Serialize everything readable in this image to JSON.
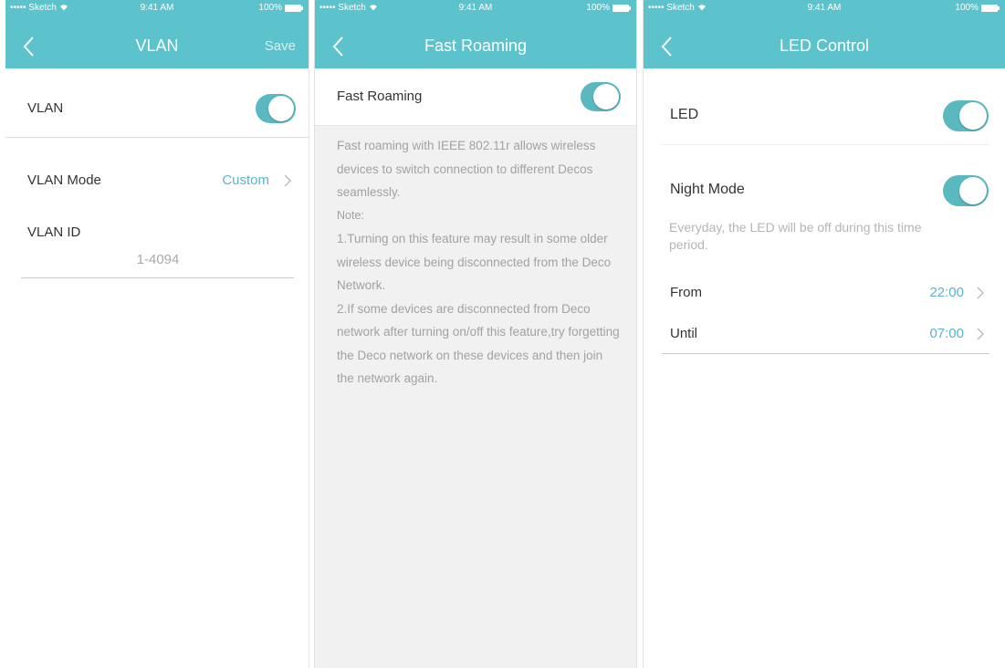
{
  "status_bar": {
    "carrier": "••••• Sketch",
    "time": "9:41 AM",
    "battery": "100%"
  },
  "vlan_screen": {
    "title": "VLAN",
    "save_label": "Save",
    "vlan_toggle_label": "VLAN",
    "vlan_enabled": true,
    "mode_label": "VLAN Mode",
    "mode_value": "Custom",
    "id_label": "VLAN ID",
    "id_placeholder": "1-4094"
  },
  "fast_roaming_screen": {
    "title": "Fast Roaming",
    "toggle_label": "Fast Roaming",
    "enabled": true,
    "description": "Fast roaming with IEEE 802.11r allows wireless devices to switch connection to different Decos seamlessly.",
    "note_label": "Note:",
    "note_1": "1.Turning on this feature may result in some older wireless device being disconnected  from the Deco Network.",
    "note_2": "2.If some devices are disconnected from Deco network after turning on/off this feature,try forgetting the Deco network on these devices and then join the network again."
  },
  "led_screen": {
    "title": "LED Control",
    "led_label": "LED",
    "led_enabled": true,
    "night_label": "Night Mode",
    "night_enabled": true,
    "night_hint": "Everyday, the LED will be off during this time period.",
    "from_label": "From",
    "from_value": "22:00",
    "until_label": "Until",
    "until_value": "07:00"
  },
  "colors": {
    "accent": "#5cc3cc",
    "toggle_on": "#5ab9bf",
    "link_value": "#5cb3cc"
  },
  "icons": {
    "back": "chevron-left-icon",
    "disclosure": "chevron-right-icon",
    "wifi": "wifi-icon",
    "battery": "battery-icon"
  }
}
